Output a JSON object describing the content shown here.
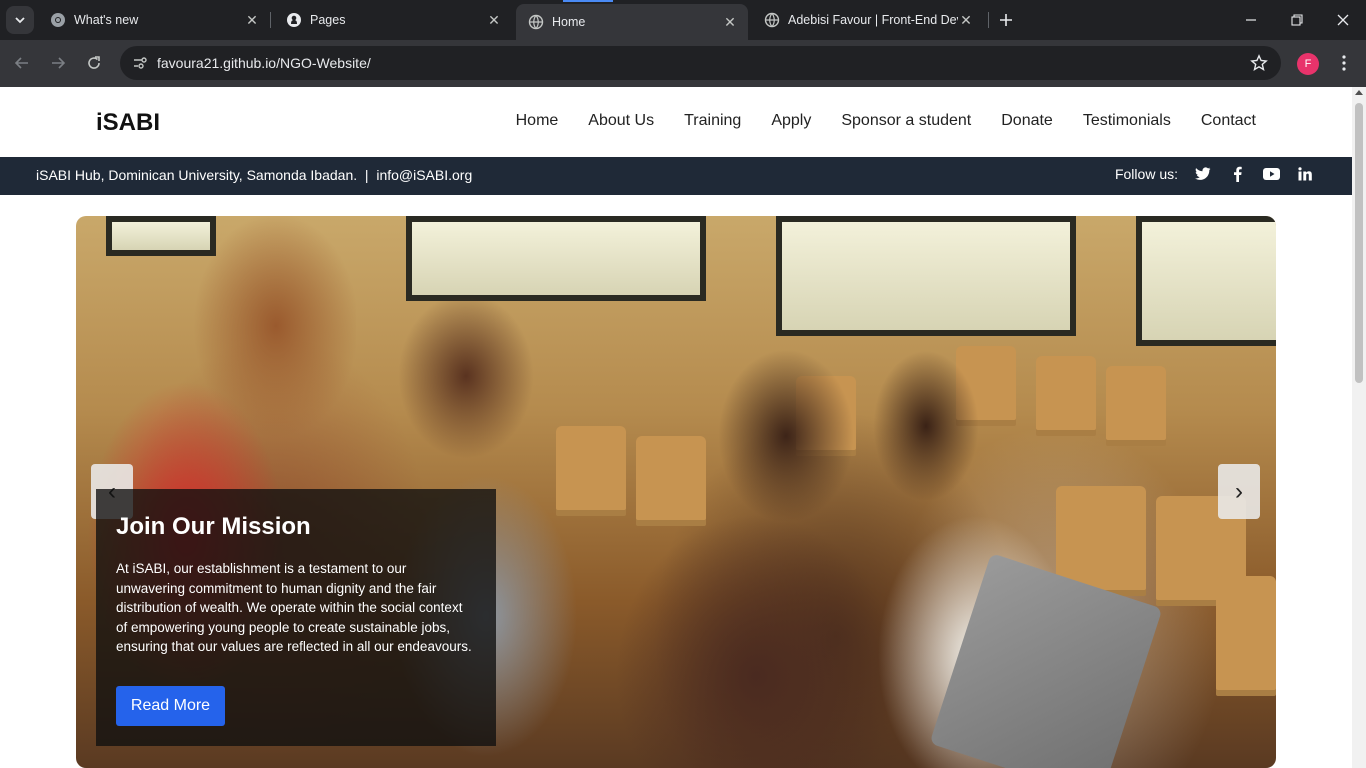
{
  "browser": {
    "tabs": [
      {
        "title": "What's new",
        "icon": "chrome-icon",
        "active": false
      },
      {
        "title": "Pages",
        "icon": "github-icon",
        "active": false
      },
      {
        "title": "Home",
        "icon": "globe-icon",
        "active": true
      },
      {
        "title": "Adebisi Favour | Front-End Deve",
        "icon": "globe-icon",
        "active": false
      }
    ],
    "url": "favoura21.github.io/NGO-Website/",
    "profile_initial": "F"
  },
  "site": {
    "logo": "iSABI",
    "nav": [
      "Home",
      "About Us",
      "Training",
      "Apply",
      "Sponsor a student",
      "Donate",
      "Testimonials",
      "Contact"
    ],
    "info": {
      "address": "iSABI Hub, Dominican University, Samonda Ibadan.",
      "separator": "|",
      "email": "info@iSABI.org",
      "follow_label": "Follow us:"
    },
    "social": [
      "twitter-icon",
      "facebook-icon",
      "youtube-icon",
      "linkedin-icon"
    ]
  },
  "hero": {
    "title": "Join Our Mission",
    "body": "At iSABI, our establishment is a testament to our unwavering commitment to human dignity and the fair distribution of wealth. We operate within the social context of empowering young people to create sustainable jobs, ensuring that our values are reflected in all our endeavours.",
    "button": "Read More",
    "prev": "‹",
    "next": "›"
  }
}
